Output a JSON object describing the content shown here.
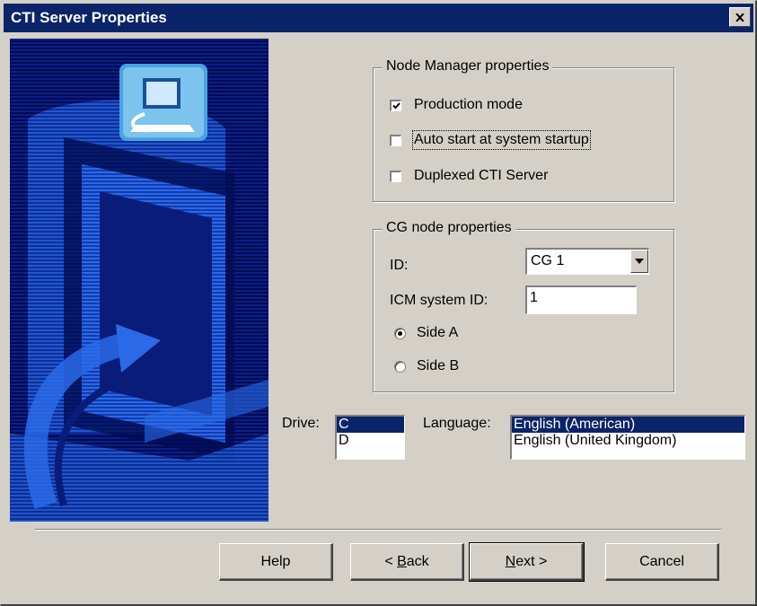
{
  "window": {
    "title": "CTI Server Properties"
  },
  "icons": {
    "close": "close-icon",
    "checkmark": "checkmark-icon",
    "dropdown": "chevron-down-icon",
    "artwork": "cti-server-graphic",
    "computer": "computer-icon"
  },
  "node_manager": {
    "legend": "Node Manager properties",
    "production_mode": {
      "label": "Production mode",
      "checked": true
    },
    "auto_start": {
      "label": "Auto start at system startup",
      "checked": false
    },
    "duplexed": {
      "label": "Duplexed CTI Server",
      "checked": false
    }
  },
  "cg_node": {
    "legend": "CG node properties",
    "id_label": "ID:",
    "id_value": "CG 1",
    "icm_label": "ICM system ID:",
    "icm_value": "1",
    "side_a": {
      "label": "Side A",
      "selected": true
    },
    "side_b": {
      "label": "Side B",
      "selected": false
    }
  },
  "drive": {
    "label": "Drive:",
    "options": [
      "C",
      "D"
    ],
    "selected": "C"
  },
  "language": {
    "label": "Language:",
    "options": [
      "English (American)",
      "English (United Kingdom)"
    ],
    "selected": "English (American)"
  },
  "buttons": {
    "help": "Help",
    "back_prefix": "< ",
    "back_mnemonic": "B",
    "back_rest": "ack",
    "next_mnemonic": "N",
    "next_rest": "ext >",
    "cancel": "Cancel"
  },
  "colors": {
    "face": "#d4d0c8",
    "title_bar": "#0a246a",
    "selection": "#0a246a",
    "art_background": "#000b52",
    "art_accent": "#2a6ae8"
  }
}
